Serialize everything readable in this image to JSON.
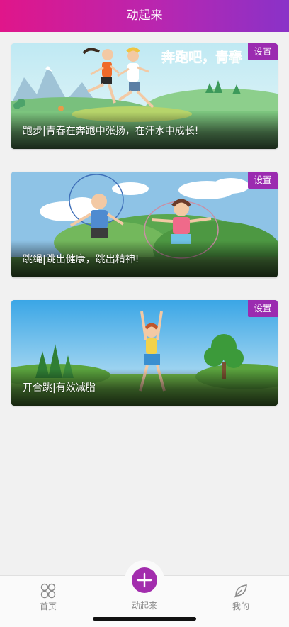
{
  "header": {
    "title": "动起来"
  },
  "cards": [
    {
      "banner_text": "奔跑吧，青春",
      "caption": "跑步|青春在奔跑中张扬，在汗水中成长!",
      "settings_label": "设置"
    },
    {
      "caption": "跳绳|跳出健康，跳出精神!",
      "settings_label": "设置"
    },
    {
      "caption": "开合跳|有效减脂",
      "settings_label": "设置"
    }
  ],
  "tabbar": {
    "home_label": "首页",
    "move_label": "动起来",
    "mine_label": "我的"
  },
  "colors": {
    "header_gradient": [
      "#e0168a",
      "#8a32c8"
    ],
    "accent": "#9b2bb0",
    "tab_text": "#8a8a8a"
  },
  "icons": [
    "grid-icon",
    "plus-icon",
    "leaf-icon"
  ]
}
